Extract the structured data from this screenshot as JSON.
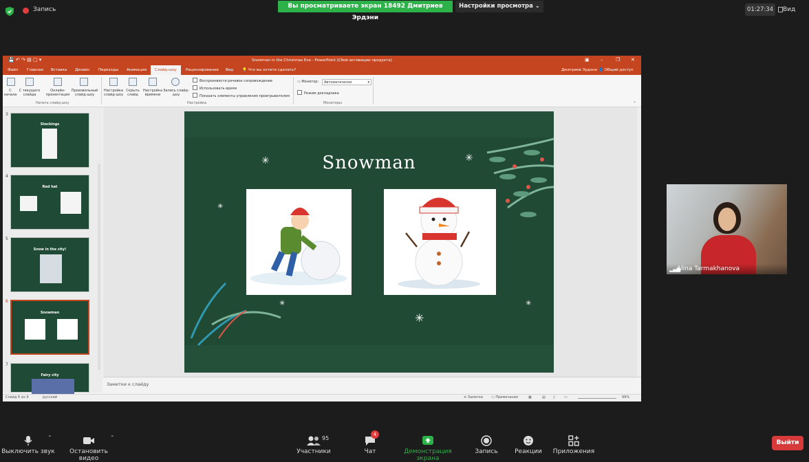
{
  "top": {
    "record_label": "Запись",
    "banner": "Вы просматриваете экран 18492 Дмитриев Эрдэни",
    "view_options": "Настройки просмотра",
    "timer": "01:27:34",
    "view_label": "Вид"
  },
  "ppt": {
    "title": "Snowman in the Christmas Eve - PowerPoint (Сбой активации продукта)",
    "tabs": [
      "Файл",
      "Главная",
      "Вставка",
      "Дизайн",
      "Переходы",
      "Анимация",
      "Слайд-шоу",
      "Рецензирование",
      "Вид",
      "Что вы хотите сделать?"
    ],
    "user": "Дмитриев Эрдэни",
    "share": "Общий доступ",
    "ribbon": {
      "from_start": "С начала",
      "from_current": "С текущего слайда",
      "online": "Онлайн-презентация",
      "custom": "Произвольный слайд-шоу",
      "setup": "Настройка слайд-шоу",
      "hide": "Скрыть слайд",
      "rehearse": "Настройка времени",
      "record": "Запись слайд-шоу",
      "group_start": "Начать слайд-шоу",
      "chk1": "Воспроизвести речевое сопровождение",
      "chk2": "Использовать время",
      "chk3": "Показать элементы управления проигрывателем",
      "group_setup": "Настройка",
      "monitor_label": "Монитор:",
      "monitor_value": "Автоматически",
      "presenter_view": "Режим докладчика",
      "group_monitors": "Мониторы"
    },
    "thumbnails": [
      {
        "num": "3",
        "title": "Stockings"
      },
      {
        "num": "4",
        "title": "Red hat"
      },
      {
        "num": "5",
        "title": "Snow in the city!"
      },
      {
        "num": "6",
        "title": "Snowman"
      },
      {
        "num": "7",
        "title": "Fairy city"
      }
    ],
    "slide_title": "Snowman",
    "notes_placeholder": "Заметки к слайду",
    "status": {
      "slide": "Слайд 6 из 9",
      "lang": "русский",
      "notes": "Заметки",
      "comments": "Примечания",
      "zoom": "99%"
    }
  },
  "participant": {
    "name": "Alina Tarmakhanova"
  },
  "toolbar": {
    "mute": "Выключить звук",
    "video": "Остановить видео",
    "participants": "Участники",
    "participants_count": "95",
    "chat": "Чат",
    "chat_badge": "4",
    "share": "Демонстрация экрана",
    "record": "Запись",
    "reactions": "Реакции",
    "apps": "Приложения",
    "leave": "Выйти"
  },
  "colors": {
    "ppt_accent": "#c4451f",
    "banner_green": "#2db24a",
    "slide_bg": "#214a35",
    "leave_red": "#d73a3a"
  }
}
